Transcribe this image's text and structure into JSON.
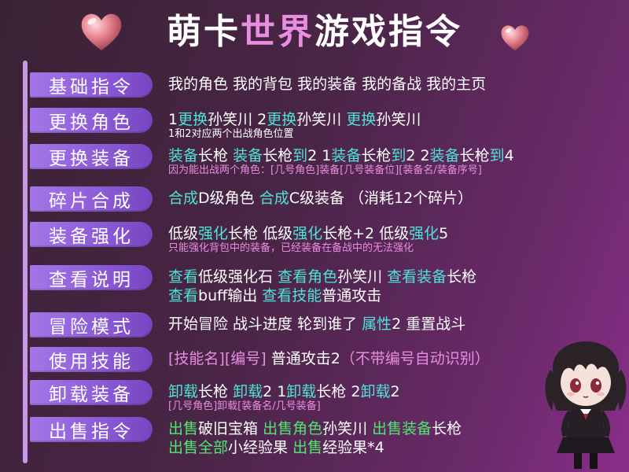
{
  "title": {
    "part1": "萌卡",
    "part2": "世界",
    "part3": "游戏指令"
  },
  "colors": {
    "accent_cyan": "#4fe3d6",
    "accent_green": "#4fe86f",
    "accent_pink": "#e98de0",
    "label_purple": "#9a6ae0"
  },
  "icons": {
    "heart_left": "heart-icon",
    "heart_right": "heart-icon",
    "mascot": "chibi-girl-illustration"
  },
  "sections": [
    {
      "label": "基础指令",
      "lines": [
        [
          [
            "w",
            "我的角色 我的背包 我的装备 我的备战 我的主页"
          ]
        ]
      ]
    },
    {
      "label": "更换角色",
      "lines": [
        [
          [
            "w",
            "1"
          ],
          [
            "c",
            "更换"
          ],
          [
            "w",
            "孙笑川 2"
          ],
          [
            "c",
            "更换"
          ],
          [
            "w",
            "孙笑川 "
          ],
          [
            "c",
            "更换"
          ],
          [
            "w",
            "孙笑川"
          ]
        ]
      ],
      "note": "1和2对应两个出战角色位置",
      "note_color": "w"
    },
    {
      "label": "更换装备",
      "lines": [
        [
          [
            "c",
            "装备"
          ],
          [
            "w",
            "长枪 "
          ],
          [
            "c",
            "装备"
          ],
          [
            "w",
            "长枪"
          ],
          [
            "c",
            "到"
          ],
          [
            "w",
            "2 1"
          ],
          [
            "c",
            "装备"
          ],
          [
            "w",
            "长枪"
          ],
          [
            "c",
            "到"
          ],
          [
            "w",
            "2 2"
          ],
          [
            "c",
            "装备"
          ],
          [
            "w",
            "长枪"
          ],
          [
            "c",
            "到"
          ],
          [
            "w",
            "4"
          ]
        ]
      ],
      "note": "因为能出战两个角色：[几号角色]装备[几号装备位][装备名/装备序号]",
      "note_color": "p"
    },
    {
      "label": "碎片合成",
      "lines": [
        [
          [
            "c",
            "合成"
          ],
          [
            "w",
            "D级角色 "
          ],
          [
            "c",
            "合成"
          ],
          [
            "w",
            "C级装备 （消耗12个碎片）"
          ]
        ]
      ]
    },
    {
      "label": "装备强化",
      "lines": [
        [
          [
            "w",
            "低级"
          ],
          [
            "c",
            "强化"
          ],
          [
            "w",
            "长枪 低级"
          ],
          [
            "c",
            "强化"
          ],
          [
            "w",
            "长枪+2 低级"
          ],
          [
            "c",
            "强化"
          ],
          [
            "w",
            "5"
          ]
        ]
      ],
      "note": "只能强化背包中的装备，已经装备在备战中的无法强化",
      "note_color": "p"
    },
    {
      "label": "查看说明",
      "lines": [
        [
          [
            "c",
            "查看"
          ],
          [
            "w",
            "低级强化石 "
          ],
          [
            "c",
            "查看角色"
          ],
          [
            "w",
            "孙笑川 "
          ],
          [
            "c",
            "查看装备"
          ],
          [
            "w",
            "长枪"
          ]
        ],
        [
          [
            "c",
            "查看"
          ],
          [
            "w",
            "buff输出 "
          ],
          [
            "c",
            "查看技能"
          ],
          [
            "w",
            "普通攻击"
          ]
        ]
      ]
    },
    {
      "label": "冒险模式",
      "lines": [
        [
          [
            "w",
            "开始冒险 战斗进度 轮到谁了 "
          ],
          [
            "c",
            "属性"
          ],
          [
            "w",
            "2 重置战斗"
          ]
        ]
      ]
    },
    {
      "label": "使用技能",
      "lines": [
        [
          [
            "p",
            "[技能名][编号]"
          ],
          [
            "w",
            " 普通攻击2"
          ],
          [
            "p",
            "（不带编号自动识别）"
          ]
        ]
      ]
    },
    {
      "label": "卸载装备",
      "lines": [
        [
          [
            "c",
            "卸载"
          ],
          [
            "w",
            "长枪 "
          ],
          [
            "c",
            "卸载"
          ],
          [
            "w",
            "2 1"
          ],
          [
            "c",
            "卸载"
          ],
          [
            "w",
            "长枪 2"
          ],
          [
            "c",
            "卸载"
          ],
          [
            "w",
            "2"
          ]
        ]
      ],
      "note": "[几号角色]卸载[装备名/几号装备]",
      "note_color": "p"
    },
    {
      "label": "出售指令",
      "lines": [
        [
          [
            "g",
            "出售"
          ],
          [
            "w",
            "破旧宝箱 "
          ],
          [
            "g",
            "出售角色"
          ],
          [
            "w",
            "孙笑川 "
          ],
          [
            "g",
            "出售装备"
          ],
          [
            "w",
            "长枪"
          ]
        ],
        [
          [
            "g",
            "出售全部"
          ],
          [
            "w",
            "小经验果 "
          ],
          [
            "g",
            "出售"
          ],
          [
            "w",
            "经验果*4"
          ]
        ]
      ]
    }
  ]
}
